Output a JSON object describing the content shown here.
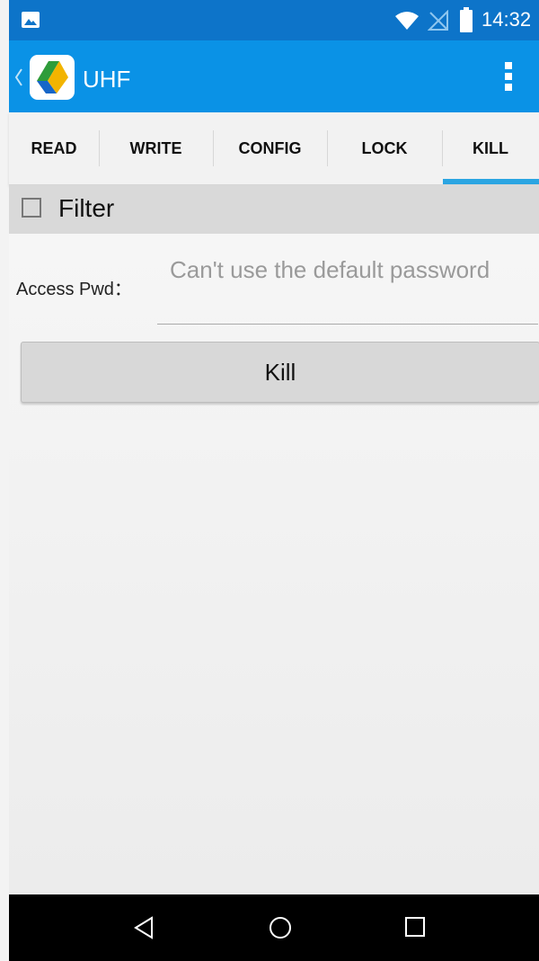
{
  "status_bar": {
    "time": "14:32",
    "icons": [
      "image-notification-icon",
      "wifi-icon",
      "no-signal-icon",
      "battery-icon"
    ]
  },
  "app_bar": {
    "title": "UHF",
    "icons": [
      "back-chevron-icon",
      "app-logo",
      "overflow-menu-icon"
    ]
  },
  "tabs": [
    {
      "label": "READ"
    },
    {
      "label": "WRITE"
    },
    {
      "label": "CONFIG"
    },
    {
      "label": "LOCK"
    },
    {
      "label": "KILL",
      "selected": true
    }
  ],
  "filter": {
    "label": "Filter",
    "checked": false
  },
  "form": {
    "access_pwd_label": "Access Pwd：",
    "access_pwd_value": "",
    "access_pwd_placeholder": "Can't use the default password"
  },
  "kill_button": {
    "label": "Kill"
  },
  "nav_bar": {
    "icons": [
      "back-triangle-icon",
      "home-circle-icon",
      "recents-square-icon"
    ]
  },
  "colors": {
    "status_bar": "#0d74c9",
    "app_bar": "#0a92e6",
    "tab_indicator": "#2ba5e2",
    "filter_bg": "#d9d9d9"
  }
}
